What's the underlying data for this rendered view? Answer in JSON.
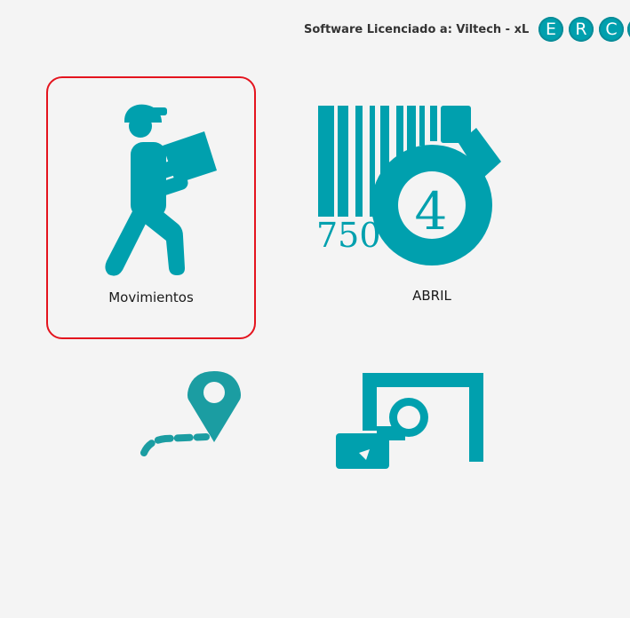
{
  "header": {
    "license_text": "Software Licenciado a: Viltech - xL",
    "buttons": [
      "E",
      "R",
      "C"
    ]
  },
  "tiles": [
    {
      "label": "Movimientos",
      "icon": "delivery-man-icon",
      "selected": true
    },
    {
      "label": "ABRIL",
      "icon": "barcode-tag-icon",
      "selected": false,
      "barcode_number": "750",
      "tag_number": "4"
    },
    {
      "label": "",
      "icon": "route-pin-icon",
      "selected": false
    },
    {
      "label": "",
      "icon": "photo-document-icon",
      "selected": false
    }
  ],
  "colors": {
    "accent": "#00a0ae",
    "selection": "#e4141e",
    "background": "#f4f4f4"
  }
}
